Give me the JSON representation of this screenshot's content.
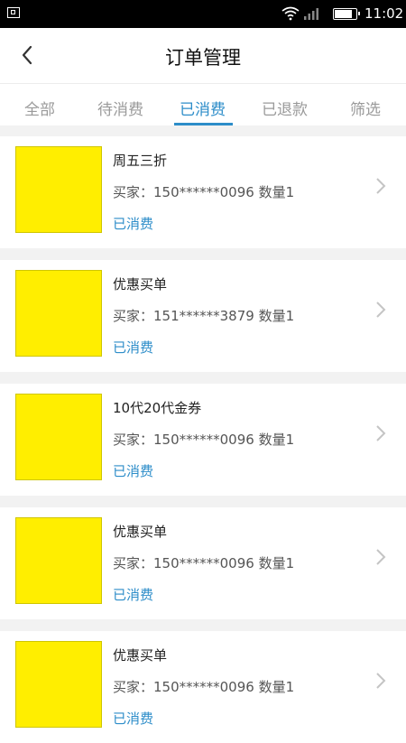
{
  "status_bar": {
    "time": "11:02",
    "battery_level": 0.85
  },
  "header": {
    "title": "订单管理",
    "back_icon": "chevron-left-icon"
  },
  "tabs": [
    {
      "label": "全部",
      "active": false
    },
    {
      "label": "待消费",
      "active": false
    },
    {
      "label": "已消费",
      "active": true
    },
    {
      "label": "已退款",
      "active": false
    },
    {
      "label": "筛选",
      "active": false
    }
  ],
  "orders": [
    {
      "name": "周五三折",
      "buyer": "买家：150******0096 数量1",
      "status": "已消费"
    },
    {
      "name": "优惠买单",
      "buyer": "买家：151******3879 数量1",
      "status": "已消费"
    },
    {
      "name": "10代20代金券",
      "buyer": "买家：150******0096 数量1",
      "status": "已消费"
    },
    {
      "name": "优惠买单",
      "buyer": "买家：150******0096 数量1",
      "status": "已消费"
    },
    {
      "name": "优惠买单",
      "buyer": "买家：150******0096 数量1",
      "status": "已消费"
    }
  ],
  "colors": {
    "accent": "#2d8dc9",
    "thumb": "#ffee00"
  }
}
